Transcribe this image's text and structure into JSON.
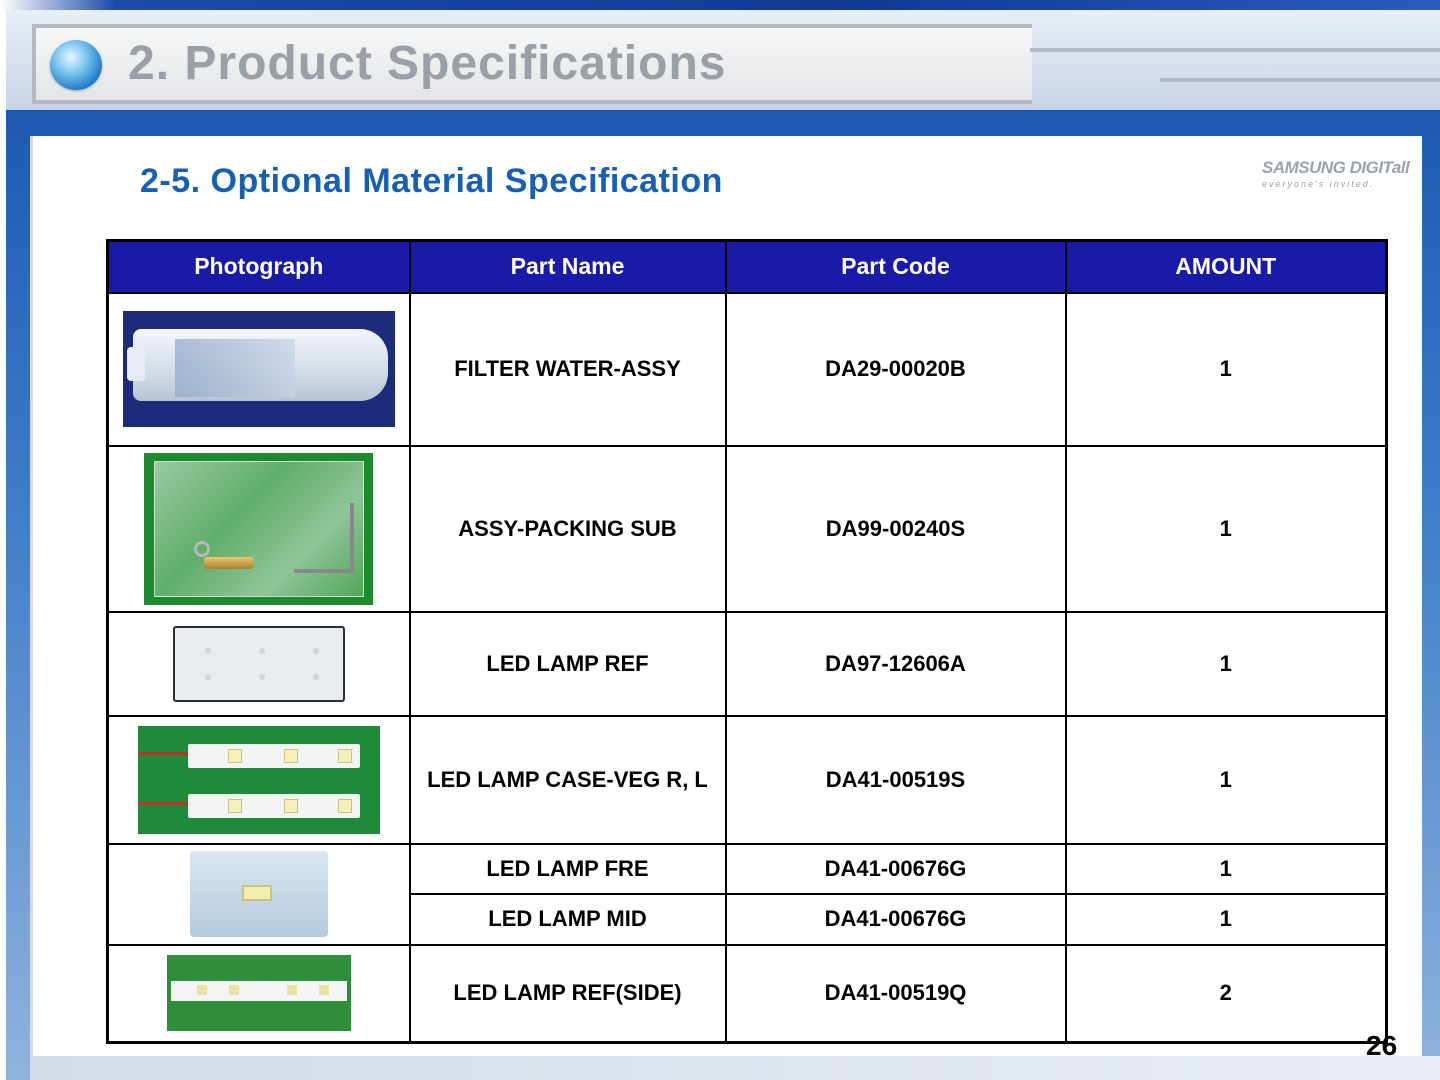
{
  "header": {
    "title": "2. Product Specifications"
  },
  "section": {
    "title": "2-5. Optional Material Specification"
  },
  "brand": {
    "line1": "SAMSUNG DIGITall",
    "line2": "everyone's invited."
  },
  "table": {
    "columns": [
      "Photograph",
      "Part Name",
      "Part Code",
      "AMOUNT"
    ],
    "rows": [
      {
        "photo": "water-filter-photo",
        "part_name": "FILTER WATER-ASSY",
        "part_code": "DA29-00020B",
        "amount": "1"
      },
      {
        "photo": "packing-sub-photo",
        "part_name": "ASSY-PACKING SUB",
        "part_code": "DA99-00240S",
        "amount": "1"
      },
      {
        "photo": "led-lamp-ref-photo",
        "part_name": "LED LAMP REF",
        "part_code": "DA97-12606A",
        "amount": "1"
      },
      {
        "photo": "led-lamp-case-veg-photo",
        "part_name": "LED LAMP CASE-VEG R, L",
        "part_code": "DA41-00519S",
        "amount": "1"
      },
      {
        "photo": "led-lamp-fre-mid-photo",
        "part_name": "LED LAMP FRE",
        "part_code": "DA41-00676G",
        "amount": "1"
      },
      {
        "photo": "led-lamp-fre-mid-photo",
        "part_name": "LED LAMP MID",
        "part_code": "DA41-00676G",
        "amount": "1"
      },
      {
        "photo": "led-lamp-ref-side-photo",
        "part_name": "LED LAMP REF(SIDE)",
        "part_code": "DA41-00519Q",
        "amount": "2"
      }
    ]
  },
  "page_number": "26",
  "colors": {
    "header_fill": "#1a1aa8",
    "section_title": "#1560b6",
    "title_gray": "#9aa0a8"
  }
}
